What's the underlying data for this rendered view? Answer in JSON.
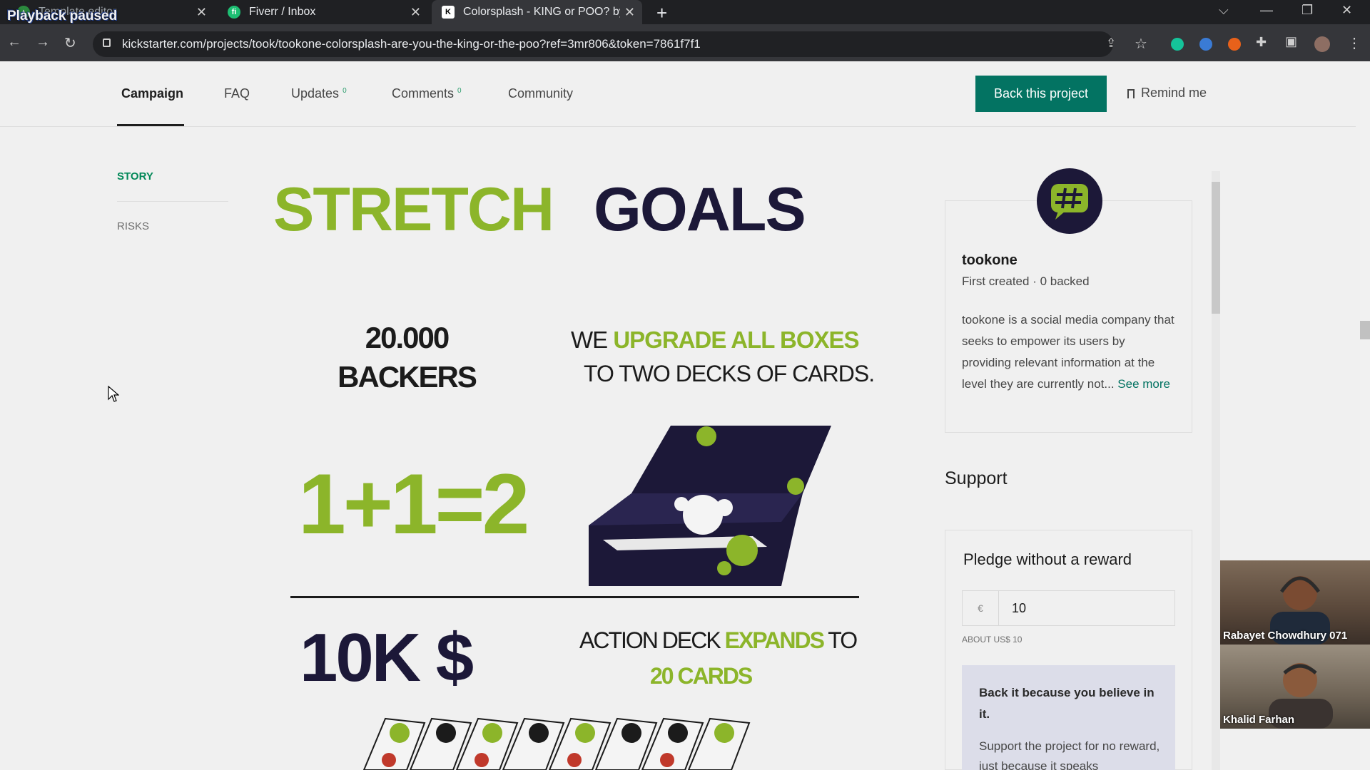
{
  "overlay": {
    "paused_label": "Playback paused"
  },
  "browser": {
    "tabs": [
      {
        "title": "Template editor"
      },
      {
        "title": "Fiverr / Inbox"
      },
      {
        "title": "Colorsplash - KING or POO? by t"
      }
    ],
    "url": "kickstarter.com/projects/took/tookone-colorsplash-are-you-the-king-or-the-poo?ref=3mr806&token=7861f7f1"
  },
  "subnav": {
    "items": [
      {
        "label": "Campaign",
        "badge": ""
      },
      {
        "label": "FAQ",
        "badge": ""
      },
      {
        "label": "Updates",
        "badge": "0"
      },
      {
        "label": "Comments",
        "badge": "0"
      },
      {
        "label": "Community",
        "badge": ""
      }
    ],
    "back_button": "Back this project",
    "remind_label": "Remind me"
  },
  "sidebar": {
    "story": "STORY",
    "risks": "RISKS"
  },
  "graphic": {
    "title_part1": "STRETCH",
    "title_part2": "GOALS",
    "goal1_number": "20.000",
    "goal1_unit": "BACKERS",
    "goal1_text_a": "WE",
    "goal1_text_b": "UPGRADE ALL BOXES",
    "goal1_text_c": "TO TWO DECKS OF CARDS.",
    "equation": "1+1=2",
    "goal2_number": "10K $",
    "goal2_text_a": "ACTION DECK",
    "goal2_text_b": "EXPANDS",
    "goal2_text_c": "TO",
    "goal2_text_d": "20 CARDS"
  },
  "creator": {
    "name": "tookone",
    "meta": "First created · 0 backed",
    "bio": "tookone is a social media company that seeks to empower its users by providing relevant information at the level they are currently not...",
    "see_more": "See more"
  },
  "support": {
    "heading": "Support",
    "pledge_heading": "Pledge without a reward",
    "currency_symbol": "€",
    "amount": "10",
    "about": "ABOUT US$ 10",
    "believe_heading": "Back it because you believe in it.",
    "believe_text": "Support the project for no reward, just because it speaks"
  },
  "video_call": {
    "participants": [
      "Rabayet Chowdhury 071",
      "Khalid Farhan"
    ]
  },
  "colors": {
    "accent": "#037362",
    "green": "#8cb52a",
    "navy": "#1c1838"
  }
}
